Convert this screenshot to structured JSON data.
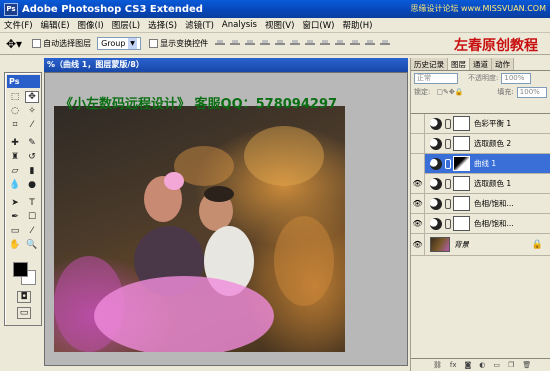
{
  "titlebar": {
    "app_logo": "Ps",
    "title": "Adobe Photoshop CS3 Extended",
    "watermark": "思缘设计论坛 www.MISSVUAN.COM"
  },
  "menu": [
    "文件(F)",
    "编辑(E)",
    "图像(I)",
    "图层(L)",
    "选择(S)",
    "滤镜(T)",
    "Analysis",
    "视图(V)",
    "窗口(W)",
    "帮助(H)"
  ],
  "options": {
    "auto_select_label": "自动选择图层",
    "auto_select_value": "Group",
    "show_transform_label": "显示变换控件",
    "brand_text": "左春原创教程"
  },
  "toolbox": {
    "badge": "Ps"
  },
  "document": {
    "title": "%（曲线 1，图层蒙版/8）",
    "caption": "《小左数码远程设计》 客服QQ：578094297"
  },
  "panel": {
    "tabs": [
      "历史记录",
      "图层",
      "通道",
      "动作"
    ],
    "blend_mode": "正常",
    "opacity_label": "不透明度:",
    "opacity_value": "100%",
    "lock_label": "锁定:",
    "fill_label": "填充:",
    "fill_value": "100%",
    "layers": [
      {
        "name": "色彩平衡 1",
        "visible": false,
        "selected": false,
        "type": "adjustment"
      },
      {
        "name": "选取颜色 2",
        "visible": false,
        "selected": false,
        "type": "adjustment"
      },
      {
        "name": "曲线 1",
        "visible": false,
        "selected": true,
        "type": "adjustment"
      },
      {
        "name": "选取颜色 1",
        "visible": true,
        "selected": false,
        "type": "adjustment"
      },
      {
        "name": "色相/饱和...",
        "visible": true,
        "selected": false,
        "type": "adjustment"
      },
      {
        "name": "色相/饱和...",
        "visible": true,
        "selected": false,
        "type": "adjustment"
      },
      {
        "name": "背景",
        "visible": true,
        "selected": false,
        "type": "image"
      }
    ],
    "bottom_icons": [
      "link-icon",
      "fx-icon",
      "mask-icon",
      "adjustment-icon",
      "folder-icon",
      "new-layer-icon",
      "trash-icon"
    ]
  }
}
